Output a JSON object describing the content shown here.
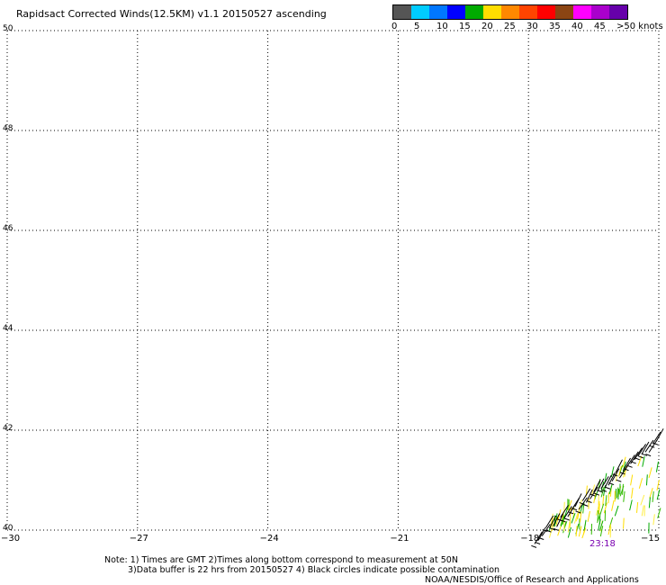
{
  "title": "Rapidsact Corrected Winds(12.5KM) v1.1 20150527 ascending",
  "colorbar": {
    "colors": [
      "#555555",
      "#00ccff",
      "#0077ff",
      "#0000ff",
      "#00aa00",
      "#ffdd00",
      "#ff8800",
      "#ff4400",
      "#ff0000",
      "#8b4513",
      "#ff00ff",
      "#aa00cc",
      "#6600aa"
    ],
    "labels": [
      "0",
      "5",
      "10",
      "15",
      "20",
      "25",
      "30",
      "35",
      "40",
      "45",
      ">50 knots"
    ]
  },
  "map": {
    "lat_labels": [
      "50",
      "48",
      "46",
      "44",
      "42",
      "40"
    ],
    "lon_labels": [
      "-30",
      "-27",
      "-24",
      "-21",
      "-18",
      "-15"
    ],
    "lat_range": [
      40,
      50
    ],
    "lon_range": [
      -30,
      -15
    ],
    "grid": "dotted",
    "time_label": "23:18"
  },
  "notes": {
    "line1": "Note: 1) Times are GMT 2)Times along bottom correspond to measurement at 50N",
    "line2": "3)Data buffer is 22 hrs from 20150527 4) Black circles indicate possible contamination",
    "line3": "NOAA/NESDIS/Office of Research and Applications"
  }
}
